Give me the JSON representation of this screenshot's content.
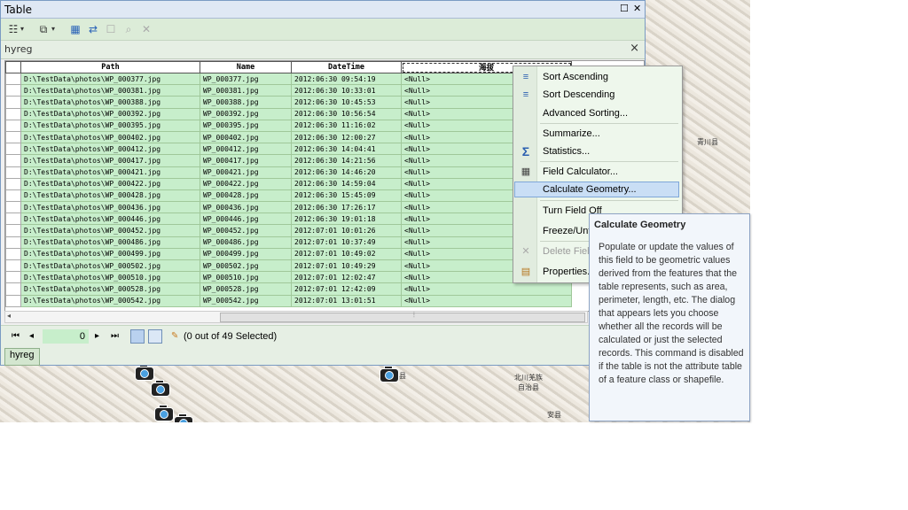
{
  "window": {
    "title": "Table",
    "maximize_glyph": "☐",
    "close_glyph": "✕"
  },
  "tab": {
    "name": "hyreg",
    "close_glyph": "×"
  },
  "grid": {
    "columns": [
      "Path",
      "Name",
      "DateTime",
      "海拔"
    ],
    "rows": [
      {
        "path": "D:\\TestData\\photos\\WP_000377.jpg",
        "name": "WP_000377.jpg",
        "datetime": "2012:06:30 09:54:19",
        "value": "<Null>"
      },
      {
        "path": "D:\\TestData\\photos\\WP_000381.jpg",
        "name": "WP_000381.jpg",
        "datetime": "2012:06:30 10:33:01",
        "value": "<Null>"
      },
      {
        "path": "D:\\TestData\\photos\\WP_000388.jpg",
        "name": "WP_000388.jpg",
        "datetime": "2012:06:30 10:45:53",
        "value": "<Null>"
      },
      {
        "path": "D:\\TestData\\photos\\WP_000392.jpg",
        "name": "WP_000392.jpg",
        "datetime": "2012:06:30 10:56:54",
        "value": "<Null>"
      },
      {
        "path": "D:\\TestData\\photos\\WP_000395.jpg",
        "name": "WP_000395.jpg",
        "datetime": "2012:06:30 11:16:02",
        "value": "<Null>"
      },
      {
        "path": "D:\\TestData\\photos\\WP_000402.jpg",
        "name": "WP_000402.jpg",
        "datetime": "2012:06:30 12:00:27",
        "value": "<Null>"
      },
      {
        "path": "D:\\TestData\\photos\\WP_000412.jpg",
        "name": "WP_000412.jpg",
        "datetime": "2012:06:30 14:04:41",
        "value": "<Null>"
      },
      {
        "path": "D:\\TestData\\photos\\WP_000417.jpg",
        "name": "WP_000417.jpg",
        "datetime": "2012:06:30 14:21:56",
        "value": "<Null>"
      },
      {
        "path": "D:\\TestData\\photos\\WP_000421.jpg",
        "name": "WP_000421.jpg",
        "datetime": "2012:06:30 14:46:20",
        "value": "<Null>"
      },
      {
        "path": "D:\\TestData\\photos\\WP_000422.jpg",
        "name": "WP_000422.jpg",
        "datetime": "2012:06:30 14:59:04",
        "value": "<Null>"
      },
      {
        "path": "D:\\TestData\\photos\\WP_000428.jpg",
        "name": "WP_000428.jpg",
        "datetime": "2012:06:30 15:45:09",
        "value": "<Null>"
      },
      {
        "path": "D:\\TestData\\photos\\WP_000436.jpg",
        "name": "WP_000436.jpg",
        "datetime": "2012:06:30 17:26:17",
        "value": "<Null>"
      },
      {
        "path": "D:\\TestData\\photos\\WP_000446.jpg",
        "name": "WP_000446.jpg",
        "datetime": "2012:06:30 19:01:18",
        "value": "<Null>"
      },
      {
        "path": "D:\\TestData\\photos\\WP_000452.jpg",
        "name": "WP_000452.jpg",
        "datetime": "2012:07:01 10:01:26",
        "value": "<Null>"
      },
      {
        "path": "D:\\TestData\\photos\\WP_000486.jpg",
        "name": "WP_000486.jpg",
        "datetime": "2012:07:01 10:37:49",
        "value": "<Null>"
      },
      {
        "path": "D:\\TestData\\photos\\WP_000499.jpg",
        "name": "WP_000499.jpg",
        "datetime": "2012:07:01 10:49:02",
        "value": "<Null>"
      },
      {
        "path": "D:\\TestData\\photos\\WP_000502.jpg",
        "name": "WP_000502.jpg",
        "datetime": "2012:07:01 10:49:29",
        "value": "<Null>"
      },
      {
        "path": "D:\\TestData\\photos\\WP_000510.jpg",
        "name": "WP_000510.jpg",
        "datetime": "2012:07:01 12:02:47",
        "value": "<Null>"
      },
      {
        "path": "D:\\TestData\\photos\\WP_000528.jpg",
        "name": "WP_000528.jpg",
        "datetime": "2012:07:01 12:42:09",
        "value": "<Null>"
      },
      {
        "path": "D:\\TestData\\photos\\WP_000542.jpg",
        "name": "WP_000542.jpg",
        "datetime": "2012:07:01 13:01:51",
        "value": "<Null>"
      }
    ]
  },
  "navigation": {
    "current_record": "0",
    "selection_status": "(0 out of 49 Selected)"
  },
  "bottom_tab": "hyreg",
  "context_menu": {
    "items": [
      {
        "label": "Sort Ascending",
        "icon": "sort-ascending-icon",
        "disabled": false
      },
      {
        "label": "Sort Descending",
        "icon": "sort-descending-icon",
        "disabled": false
      },
      {
        "label": "Advanced Sorting...",
        "icon": "",
        "disabled": false
      },
      {
        "label": "Summarize...",
        "icon": "",
        "disabled": false
      },
      {
        "label": "Statistics...",
        "icon": "sigma-icon",
        "disabled": false
      },
      {
        "label": "Field Calculator...",
        "icon": "calculator-icon",
        "disabled": false
      },
      {
        "label": "Calculate Geometry...",
        "icon": "",
        "disabled": false,
        "hover": true
      },
      {
        "label": "Turn Field Off",
        "icon": "",
        "disabled": false
      },
      {
        "label": "Freeze/Unfreeze Column",
        "icon": "",
        "disabled": false
      },
      {
        "label": "Delete Field",
        "icon": "delete-icon",
        "disabled": true
      },
      {
        "label": "Properties...",
        "icon": "properties-icon",
        "disabled": false
      }
    ]
  },
  "tooltip": {
    "title": "Calculate Geometry",
    "body": "Populate or update the values of this field to be geometric values derived from the features that the table represents, such as area, perimeter, length, etc. The dialog that appears lets you choose whether all the records will be calculated or just the selected records. This command is disabled if the table is not the attribute table of a feature class or shapefile."
  },
  "map_labels": [
    "青川县",
    "北川羌族",
    "自治县",
    "安县",
    "县"
  ]
}
